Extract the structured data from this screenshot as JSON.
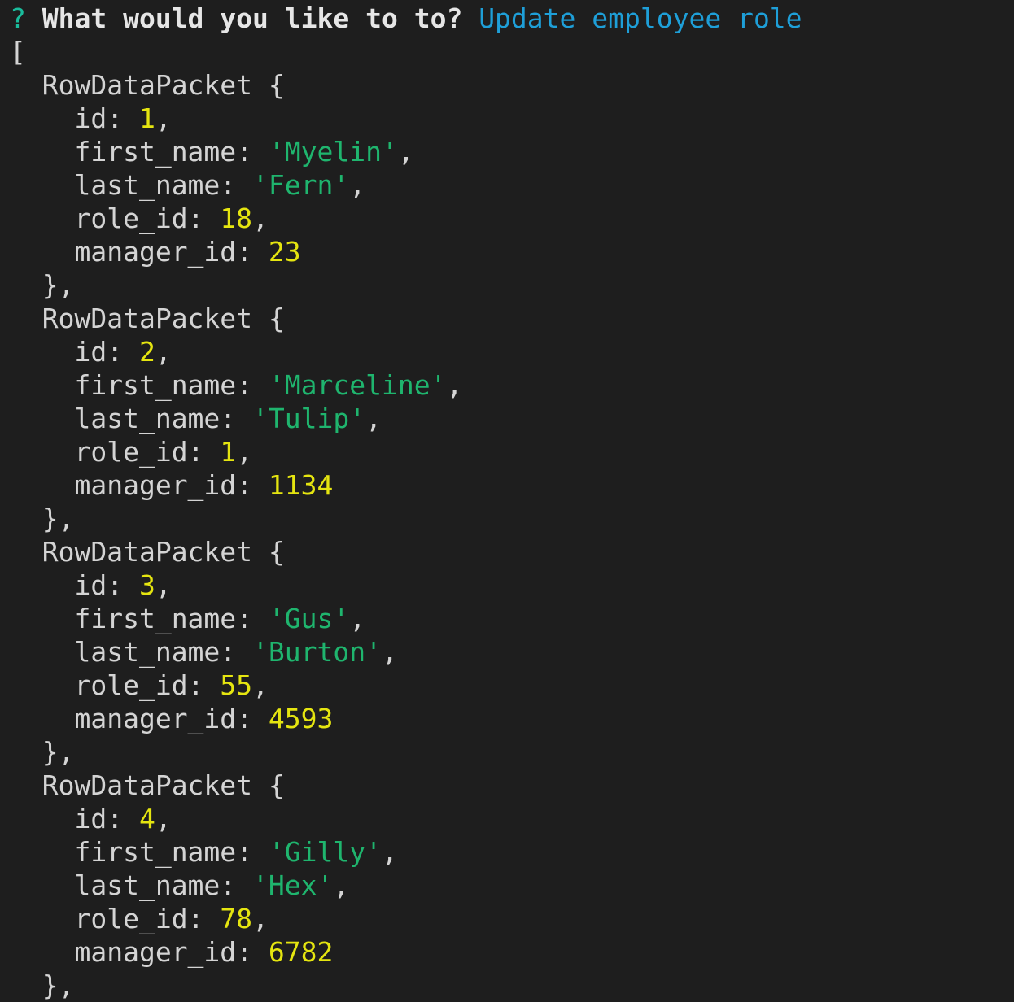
{
  "prompt": {
    "marker": "?",
    "question": "What would you like to to?",
    "answer": "Update employee role"
  },
  "open_bracket": "[",
  "packet_label": "RowDataPacket",
  "fields": {
    "id": "id",
    "first_name": "first_name",
    "last_name": "last_name",
    "role_id": "role_id",
    "manager_id": "manager_id"
  },
  "rows": [
    {
      "id": "1",
      "first_name": "'Myelin'",
      "last_name": "'Fern'",
      "role_id": "18",
      "manager_id": "23"
    },
    {
      "id": "2",
      "first_name": "'Marceline'",
      "last_name": "'Tulip'",
      "role_id": "1",
      "manager_id": "1134"
    },
    {
      "id": "3",
      "first_name": "'Gus'",
      "last_name": "'Burton'",
      "role_id": "55",
      "manager_id": "4593"
    },
    {
      "id": "4",
      "first_name": "'Gilly'",
      "last_name": "'Hex'",
      "role_id": "78",
      "manager_id": "6782"
    }
  ],
  "colors": {
    "background": "#1e1e1e",
    "text": "#d4d4d4",
    "prompt_marker": "#1abc9c",
    "answer": "#1e9fd8",
    "string": "#1fb56e",
    "number": "#e5e510"
  }
}
